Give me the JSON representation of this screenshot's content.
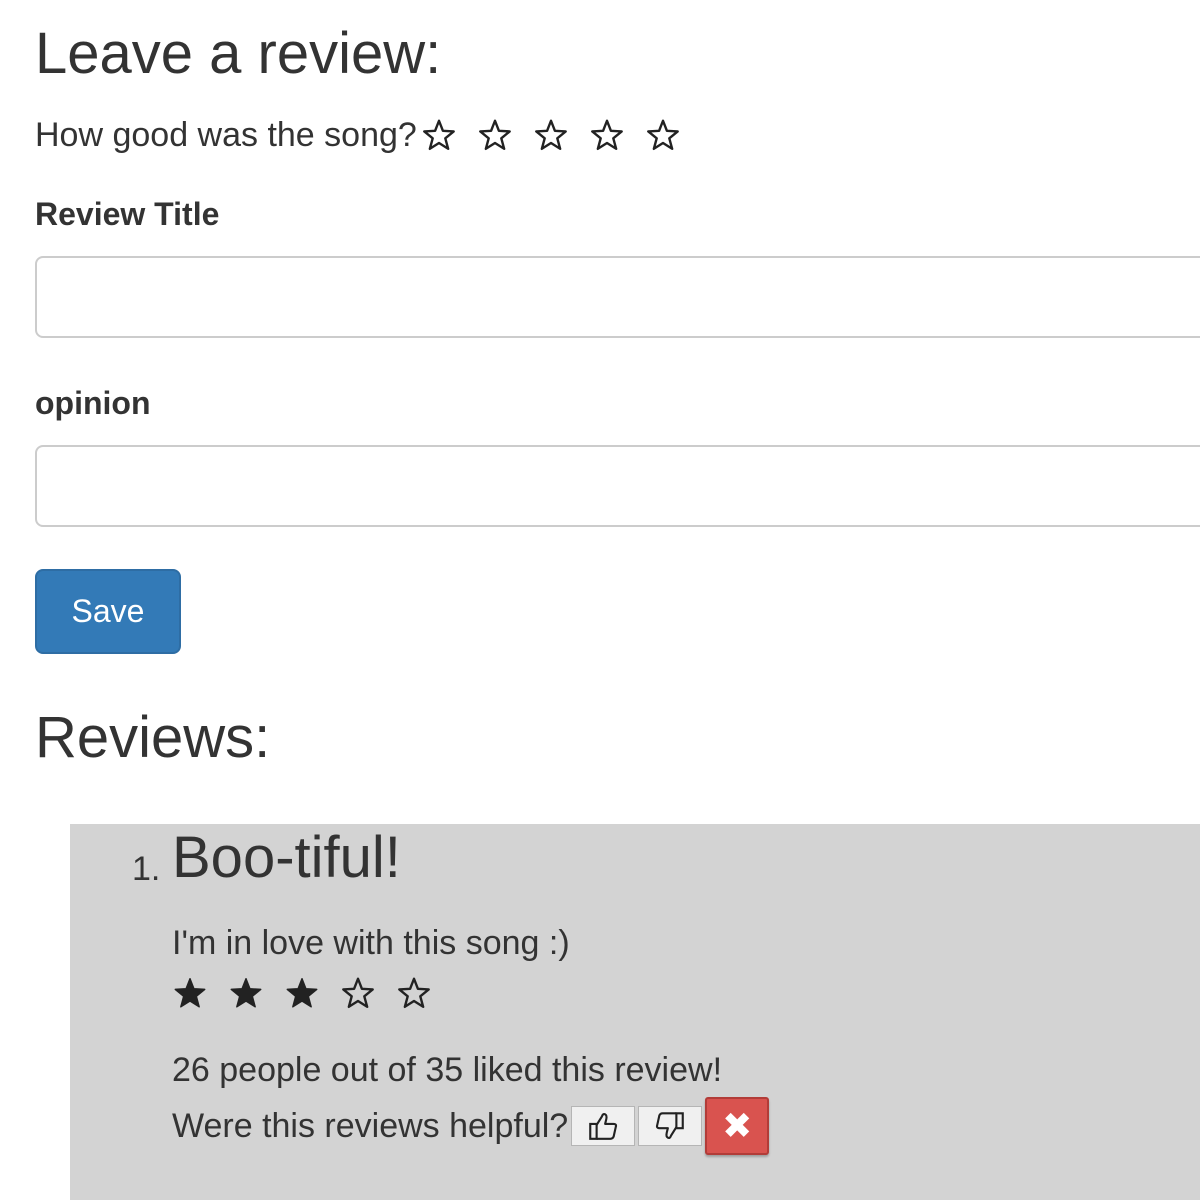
{
  "form": {
    "heading": "Leave a review:",
    "rating_question": "How good was the song?",
    "rating_value": 0,
    "rating_max": 5,
    "title_label": "Review Title",
    "title_value": "",
    "opinion_label": "opinion",
    "opinion_value": "",
    "save_label": "Save"
  },
  "reviews": {
    "heading": "Reviews:",
    "items": [
      {
        "number": "1.",
        "title": "Boo-tiful!",
        "body": "I'm in love with this song :)",
        "rating": 3,
        "rating_max": 5,
        "liked_text": "26 people out of 35 liked this review!",
        "helpful_question": "Were this reviews helpful?",
        "delete_glyph": "✖"
      }
    ]
  },
  "colors": {
    "primary": "#337ab7",
    "danger": "#d9534f",
    "review_bg": "#d3d3d3",
    "text": "#333333"
  },
  "icons": {
    "star_empty": "star-outline-icon",
    "star_filled": "star-filled-icon",
    "thumbs_up": "thumbs-up-icon",
    "thumbs_down": "thumbs-down-icon",
    "delete": "close-icon"
  }
}
